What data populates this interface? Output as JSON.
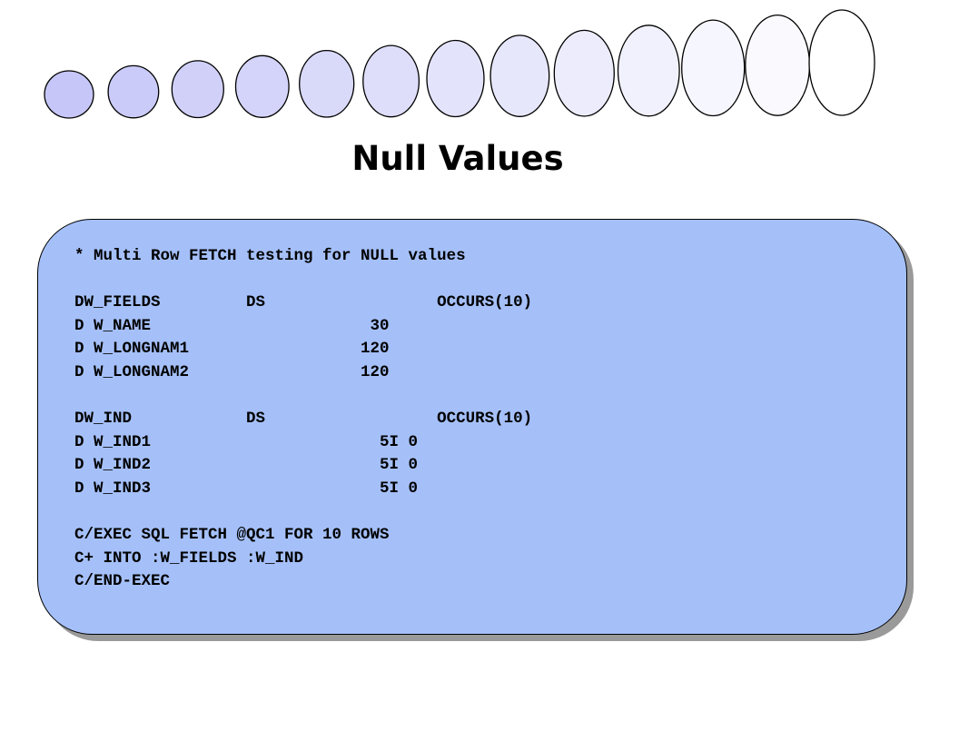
{
  "slide": {
    "title": "Null Values"
  },
  "decoration": {
    "name": "ellipse-row",
    "count": 13,
    "fill_start": "#c6c6f8",
    "fill_end": "#ffffff",
    "stroke": "#000000"
  },
  "code_block": {
    "background": "#a5c0f9",
    "lines": [
      "* Multi Row FETCH testing for NULL values",
      "",
      "DW_FIELDS         DS                  OCCURS(10)",
      "D W_NAME                       30",
      "D W_LONGNAM1                  120",
      "D W_LONGNAM2                  120",
      "",
      "DW_IND            DS                  OCCURS(10)",
      "D W_IND1                        5I 0",
      "D W_IND2                        5I 0",
      "D W_IND3                        5I 0",
      "",
      "C/EXEC SQL FETCH @QC1 FOR 10 ROWS",
      "C+ INTO :W_FIELDS :W_IND",
      "C/END-EXEC"
    ]
  }
}
